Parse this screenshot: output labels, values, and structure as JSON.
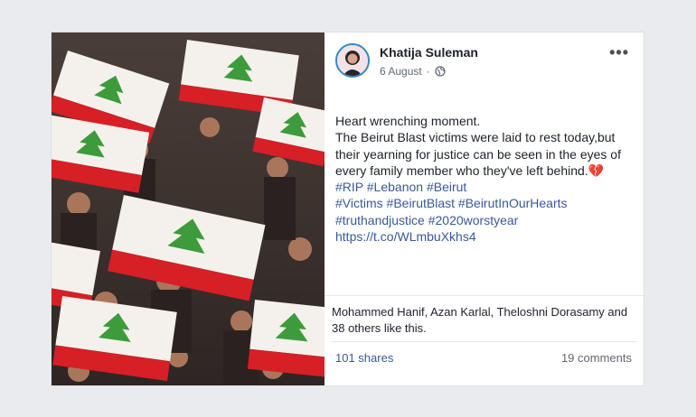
{
  "post": {
    "author": "Khatija Suleman",
    "date": "6 August",
    "dot": "·",
    "more_label": "•••",
    "text_lines": [
      "Heart wrenching moment.",
      "The Beirut Blast victims were laid to rest today,but",
      "their yearning for justice can be seen in the eyes of",
      "every family member who they've left behind."
    ],
    "heart_emoji": "💔",
    "hashtag_lines": [
      "#RIP #Lebanon #Beirut",
      "#Victims #BeirutBlast #BeirutInOurHearts",
      "#truthandjustice #2020worstyear"
    ],
    "link": "https://t.co/WLmbuXkhs4",
    "likes_text": "Mohammed Hanif, Azan Karlal, Theloshni Dorasamy and 38 others like this.",
    "shares": "101 shares",
    "comments": "19 comments"
  },
  "icons": {
    "privacy": "globe-icon",
    "menu": "more-options-icon"
  },
  "colors": {
    "link": "#385898",
    "coffin_flag_red": "#d71f26",
    "cedar_green": "#3d9b3b"
  }
}
